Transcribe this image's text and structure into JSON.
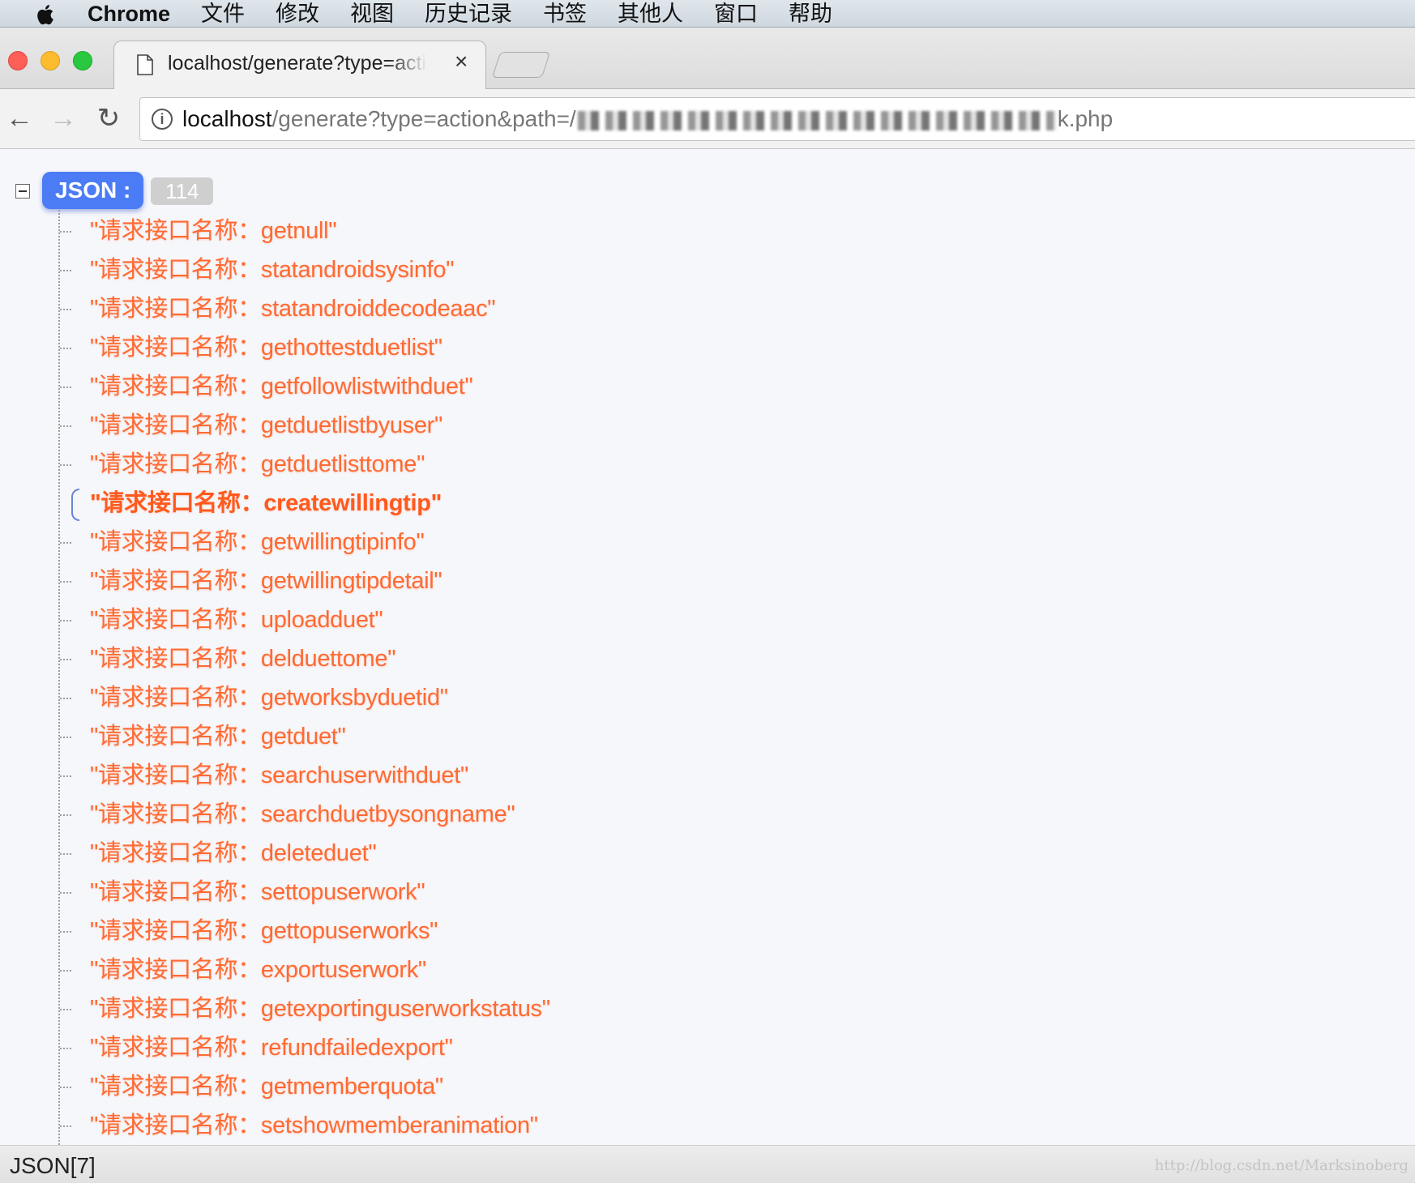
{
  "menubar": {
    "app": "Chrome",
    "items": [
      "文件",
      "修改",
      "视图",
      "历史记录",
      "书签",
      "其他人",
      "窗口",
      "帮助"
    ]
  },
  "tab": {
    "title": "localhost/generate?type=action",
    "close": "×"
  },
  "toolbar": {
    "back": "←",
    "forward": "→",
    "reload": "↻",
    "info": "i",
    "url_host": "localhost",
    "url_rest": "/generate?type=action&path=/",
    "url_tail": "k.php"
  },
  "viewer": {
    "root_label": "JSON :",
    "count": "114",
    "prefix": "\"请求接口名称：",
    "highlighted_index": 7,
    "items": [
      "getnull",
      "statandroidsysinfo",
      "statandroiddecodeaac",
      "gethottestduetlist",
      "getfollowlistwithduet",
      "getduetlistbyuser",
      "getduetlisttome",
      "createwillingtip",
      "getwillingtipinfo",
      "getwillingtipdetail",
      "uploadduet",
      "delduettome",
      "getworksbyduetid",
      "getduet",
      "searchuserwithduet",
      "searchduetbysongname",
      "deleteduet",
      "settopuserwork",
      "gettopuserworks",
      "exportuserwork",
      "getexportinguserworkstatus",
      "refundfailedexport",
      "getmemberquota",
      "setshowmemberanimation"
    ]
  },
  "status": {
    "path": "JSON[7]",
    "watermark": "http://blog.csdn.net/Marksinoberg"
  },
  "colors": {
    "string": "#ff6a32",
    "badge": "#4b7cf5",
    "count_badge": "#cfcfcf"
  }
}
